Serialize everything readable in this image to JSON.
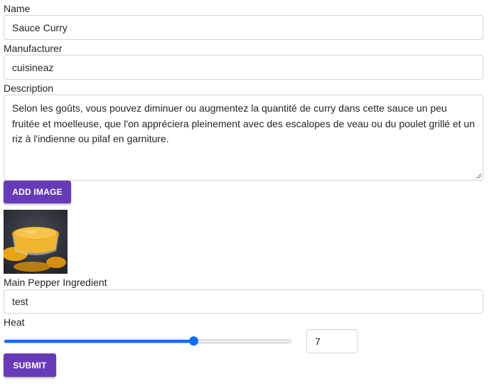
{
  "form": {
    "name_label": "Name",
    "name_value": "Sauce Curry",
    "manufacturer_label": "Manufacturer",
    "manufacturer_value": "cuisineaz",
    "description_label": "Description",
    "description_value": "Selon les goûts, vous pouvez diminuer ou augmentez la quantité de curry dans cette sauce un peu fruitée et moelleuse, que l'on appréciera pleinement avec des escalopes de veau ou du poulet grillé et un riz à l'indienne ou pilaf en garniture.",
    "add_image_label": "ADD IMAGE",
    "main_pepper_label": "Main Pepper Ingredient",
    "main_pepper_value": "test",
    "heat_label": "Heat",
    "heat_value": "7",
    "heat_fraction": 0.66,
    "submit_label": "SUBMIT"
  },
  "image": {
    "icon": "curry-sauce-bowl-photo"
  },
  "colors": {
    "accent_button": "#673ab7",
    "slider": "#0d6efd"
  }
}
